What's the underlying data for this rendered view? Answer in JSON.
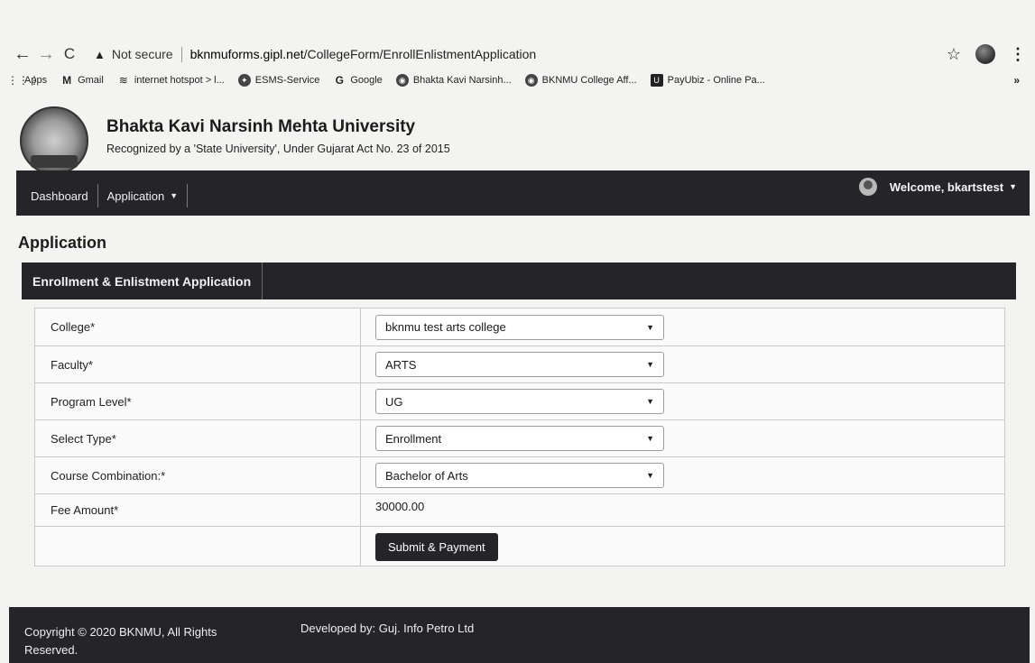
{
  "browser": {
    "security_label": "Not secure",
    "url_host": "bknmuforms.gipl.net",
    "url_path": "/CollegeForm/EnrollEnlistmentApplication",
    "bookmarks": [
      {
        "label": "Apps",
        "icon": "apps-grid-icon"
      },
      {
        "label": "Gmail",
        "icon": "gmail-icon"
      },
      {
        "label": "internet hotspot > l...",
        "icon": "wifi-icon"
      },
      {
        "label": "ESMS-Service",
        "icon": "esms-icon"
      },
      {
        "label": "Google",
        "icon": "google-icon"
      },
      {
        "label": "Bhakta Kavi Narsinh...",
        "icon": "site-icon"
      },
      {
        "label": "BKNMU College Aff...",
        "icon": "site-icon"
      },
      {
        "label": "PayUbiz - Online Pa...",
        "icon": "payubiz-icon"
      }
    ],
    "more_bookmarks": "»"
  },
  "site": {
    "university_name": "Bhakta Kavi Narsinh Mehta University",
    "subtitle": "Recognized by a 'State University', Under Gujarat Act No. 23 of 2015"
  },
  "nav": {
    "dashboard": "Dashboard",
    "application": "Application",
    "welcome": "Welcome, bkartstest"
  },
  "page": {
    "title": "Application",
    "panel_title": "Enrollment & Enlistment Application"
  },
  "form": {
    "fields": [
      {
        "label": "College*",
        "value": "bknmu test arts college"
      },
      {
        "label": "Faculty*",
        "value": "ARTS"
      },
      {
        "label": "Program Level*",
        "value": "UG"
      },
      {
        "label": "Select Type*",
        "value": "Enrollment"
      },
      {
        "label": "Course Combination:*",
        "value": "Bachelor of Arts"
      }
    ],
    "fee_label": "Fee Amount*",
    "fee_value": "30000.00",
    "submit_label": "Submit & Payment"
  },
  "footer": {
    "copyright": "Copyright © 2020 BKNMU, All Rights Reserved.",
    "developer": "Developed by: Guj. Info Petro Ltd"
  }
}
